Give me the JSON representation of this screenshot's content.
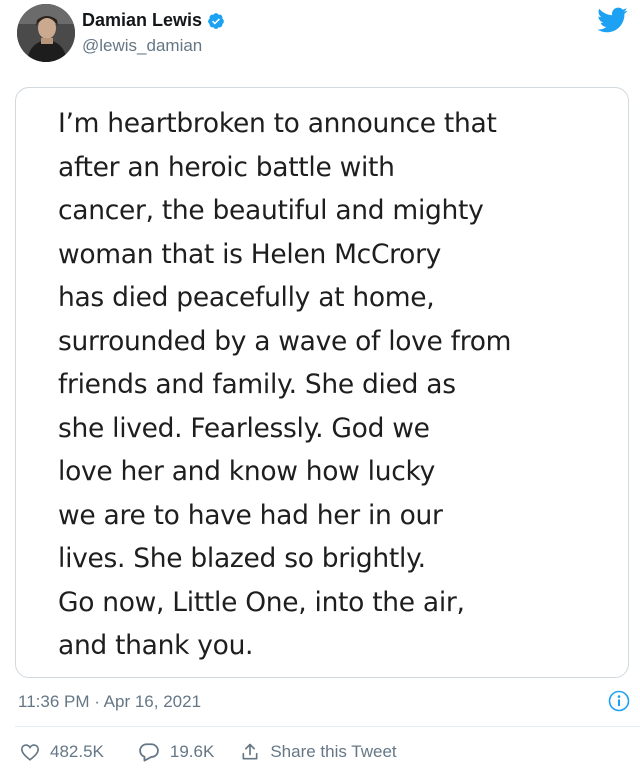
{
  "author": {
    "display_name": "Damian Lewis",
    "handle": "@lewis_damian",
    "verified": true
  },
  "brand": {
    "icon": "twitter-bird-icon",
    "color": "#1da1f2"
  },
  "note_image": {
    "lines": [
      "I’m heartbroken to announce that",
      "after an heroic battle with",
      "cancer, the beautiful and mighty",
      "woman that is Helen McCrory",
      "has died peacefully at home,",
      "surrounded by a wave of love from",
      "friends and family. She died as",
      "she lived. Fearlessly. God we",
      "love her and know how lucky",
      "we are to have had her in our",
      "lives. She blazed so brightly.",
      "Go now, Little One, into the air,",
      "and thank you."
    ]
  },
  "meta": {
    "timestamp": "11:36 PM · Apr 16, 2021",
    "info_icon": "info-icon"
  },
  "actions": {
    "likes": "482.5K",
    "replies": "19.6K",
    "share_label": "Share this Tweet"
  }
}
